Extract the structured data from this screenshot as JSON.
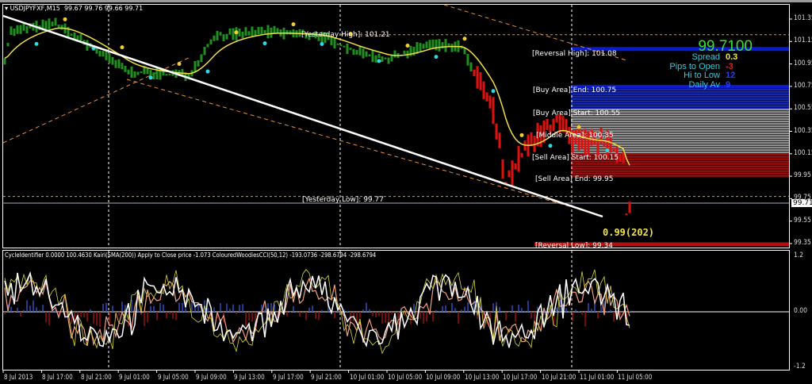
{
  "header": {
    "symbol": "USDJPYFXF,M15",
    "ohlc": "99.67 99.76 99.66 99.71"
  },
  "indicator_title": "CycleIdentifier 0.0000 100.4630  Kairi(SMA(200)) Apply to Close price -1.073  ColouredWoodiesCCI(50,12) -193.0736 -298.6794 -298.6794",
  "info_panel": {
    "bid": "99.7100",
    "rows": [
      {
        "label": "Spread",
        "value": "0.3",
        "color": "#f2e24a"
      },
      {
        "label": "Pips to Open",
        "value": "-3",
        "color": "#e02020"
      },
      {
        "label": "Hi to Low",
        "value": "12",
        "color": "#2040ff"
      },
      {
        "label": "Daily Av",
        "value": "9",
        "color": "#2040ff"
      }
    ]
  },
  "levels": {
    "yesterday_high": {
      "label": "[Yesterday High]: 101.21",
      "price": 101.21
    },
    "yesterday_low": {
      "label": "[Yesterday Low]: 99.77",
      "price": 99.77
    },
    "reversal_high": {
      "label": "[Reversal High]: 101.08",
      "price": 101.08
    },
    "buy_end": {
      "label": "[Buy Area] End: 100.75",
      "price": 100.75
    },
    "buy_start": {
      "label": "[Buy Area] Start: 100.55",
      "price": 100.55
    },
    "middle": {
      "label": "[Middle Area]: 100.35",
      "price": 100.35
    },
    "sell_start": {
      "label": "[Sell Area] Start: 100.15",
      "price": 100.15
    },
    "sell_end": {
      "label": "[Sell Area] End: 99.95",
      "price": 99.95
    },
    "reversal_low": {
      "label": "[Reversal Low]: 99.34",
      "price": 99.34
    }
  },
  "distance_label": "0.99(202)",
  "bid_tag": "99.71",
  "price_axis": [
    "101.35",
    "101.15",
    "100.95",
    "100.75",
    "100.55",
    "100.35",
    "100.15",
    "99.95",
    "99.75",
    "99.55",
    "99.35"
  ],
  "sub_axis": [
    "1.2",
    "0.00",
    "-1.2"
  ],
  "time_axis": [
    "8 Jul 2013",
    "8 Jul 17:00",
    "8 Jul 21:00",
    "9 Jul 01:00",
    "9 Jul 05:00",
    "9 Jul 09:00",
    "9 Jul 13:00",
    "9 Jul 17:00",
    "9 Jul 21:00",
    "10 Jul 01:00",
    "10 Jul 05:00",
    "10 Jul 09:00",
    "10 Jul 13:00",
    "10 Jul 17:00",
    "10 Jul 21:00",
    "11 Jul 01:00",
    "11 Jul 05:00"
  ],
  "chart_data": {
    "type": "candlestick",
    "price_range": [
      99.3,
      101.45
    ],
    "bars": 198,
    "price_anchors": [
      [
        0,
        101.0
      ],
      [
        2,
        101.24
      ],
      [
        16,
        101.31
      ],
      [
        39,
        100.88
      ],
      [
        58,
        100.85
      ],
      [
        66,
        101.2
      ],
      [
        82,
        101.24
      ],
      [
        99,
        101.2
      ],
      [
        111,
        101.06
      ],
      [
        121,
        100.99
      ],
      [
        134,
        101.13
      ],
      [
        144,
        101.1
      ],
      [
        149,
        100.81
      ],
      [
        154,
        100.53
      ],
      [
        158,
        99.9
      ],
      [
        164,
        100.18
      ],
      [
        174,
        100.46
      ],
      [
        179,
        100.25
      ],
      [
        189,
        100.25
      ],
      [
        195,
        100.1
      ],
      [
        196,
        99.61
      ],
      [
        197,
        99.71
      ]
    ],
    "colors": {
      "up": "#1f8f1f",
      "down": "#e01010"
    }
  }
}
